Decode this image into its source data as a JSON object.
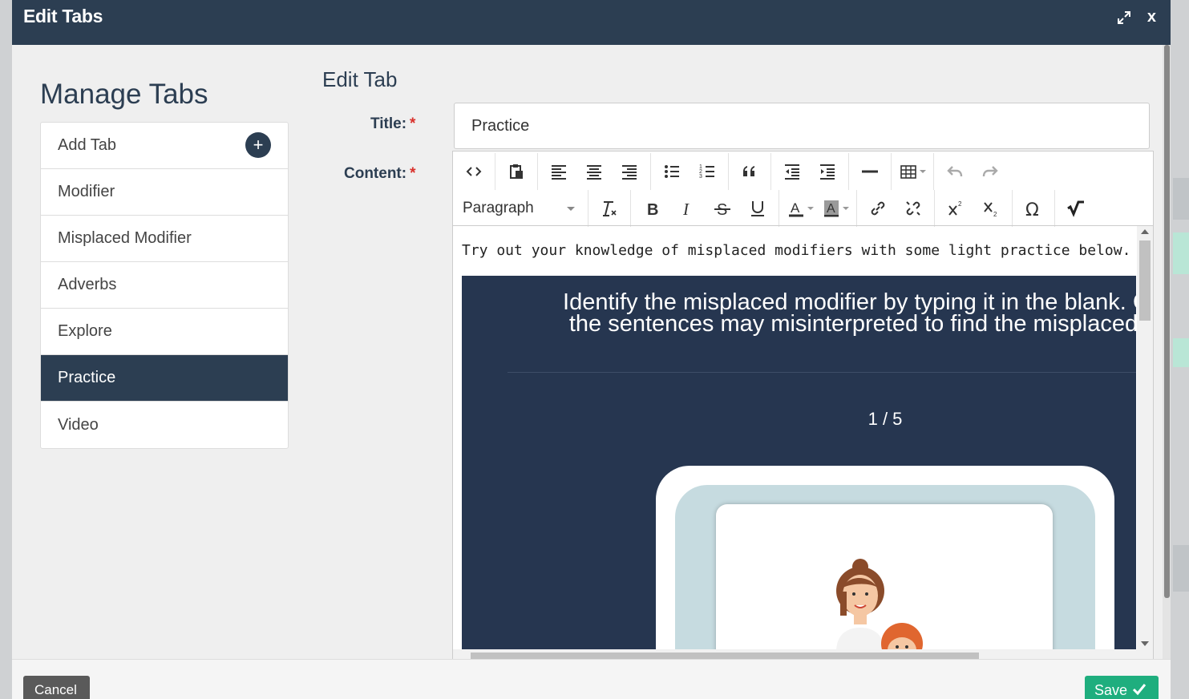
{
  "modal": {
    "title": "Edit Tabs",
    "close_label": "x"
  },
  "sidebar": {
    "title": "Manage Tabs",
    "items": [
      {
        "label": "Add Tab",
        "icon": "plus-icon",
        "add_symbol": "+"
      },
      {
        "label": "Modifier"
      },
      {
        "label": "Misplaced Modifier"
      },
      {
        "label": "Adverbs"
      },
      {
        "label": "Explore"
      },
      {
        "label": "Practice",
        "active": true
      },
      {
        "label": "Video"
      }
    ]
  },
  "form": {
    "heading": "Edit Tab",
    "title_label": "Title:",
    "title_value": "Practice",
    "content_label": "Content:",
    "required_mark": "*"
  },
  "editor": {
    "format_dropdown": "Paragraph",
    "intro_text": "Try out your knowledge of misplaced modifiers with some light practice below.",
    "instruction_line1": "Identify the misplaced modifier by typing it in the blank. Co",
    "instruction_line2": "the sentences may misinterpreted to find the misplaced",
    "counter": "1 / 5"
  },
  "footer": {
    "cancel_label": "Cancel",
    "save_label": "Save"
  },
  "colors": {
    "header": "#2c3e52",
    "save": "#1fae7e",
    "cancel": "#5a5a5a",
    "content_bg": "#263650"
  }
}
